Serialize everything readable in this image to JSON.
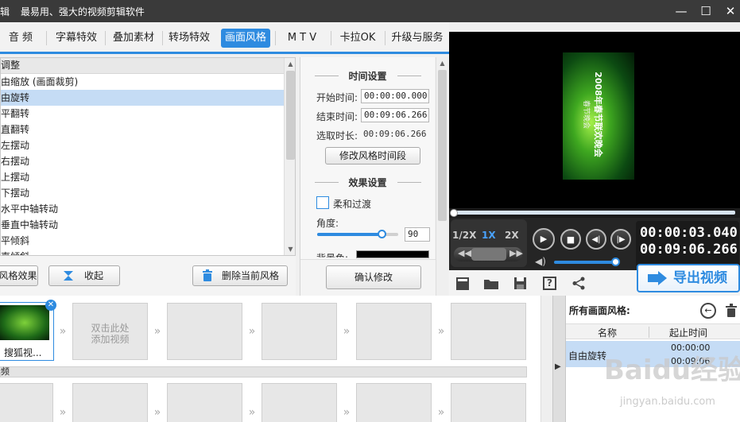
{
  "app": {
    "title_char": "辑",
    "title": "最易用、强大的视频剪辑软件",
    "window_buttons": {
      "minimize": "—",
      "maximize": "☐",
      "close": "✕"
    }
  },
  "tabs": [
    {
      "label": "音 频",
      "active": false
    },
    {
      "label": "字幕特效",
      "active": false
    },
    {
      "label": "叠加素材",
      "active": false
    },
    {
      "label": "转场特效",
      "active": false
    },
    {
      "label": "画面风格",
      "active": true
    },
    {
      "label": "M T V",
      "active": false
    },
    {
      "label": "卡拉OK",
      "active": false
    },
    {
      "label": "升级与服务",
      "active": false
    }
  ],
  "style_list": {
    "header": "调整",
    "items": [
      "由缩放 (画面裁剪)",
      "由旋转",
      "平翻转",
      "直翻转",
      "左摆动",
      "右摆动",
      "上摆动",
      "下摆动",
      "水平中轴转动",
      "垂直中轴转动",
      "平倾斜",
      "直倾斜"
    ],
    "selected_index": 1
  },
  "list_buttons": {
    "add_effect": "风格效果",
    "collapse": "收起",
    "delete_current": "删除当前风格"
  },
  "settings": {
    "time_section": "时间设置",
    "start_label": "开始时间:",
    "start_value": "00:00:00.000",
    "end_label": "结束时间:",
    "end_value": "00:09:06.266",
    "duration_label": "选取时长:",
    "duration_value": "00:09:06.266",
    "modify_time_button": "修改风格时间段",
    "effect_section": "效果设置",
    "soft_transition_label": "柔和过渡",
    "soft_transition_checked": false,
    "angle_label": "角度:",
    "angle_value": "90",
    "angle_slider_fraction": 0.8,
    "bg_color_label": "背景色:",
    "bg_color": "#000000",
    "confirm_button": "确认修改"
  },
  "preview": {
    "video_caption_line1": "2008年春节联欢晚会",
    "video_caption_line2": "春节晚会",
    "seek_fraction": 0.0
  },
  "playback": {
    "speeds": [
      "1/2X",
      "1X",
      "2X"
    ],
    "active_speed": "1X",
    "current_time": "00:00:03.040",
    "total_time": "00:09:06.266",
    "volume_fraction": 1.0
  },
  "toolbar": {
    "export_button": "导出视频",
    "icons": [
      "new-icon",
      "open-folder-icon",
      "save-icon",
      "help-icon",
      "share-icon"
    ]
  },
  "timeline": {
    "clip_label": "搜狐视...",
    "add_video_hint_line1": "双击此处",
    "add_video_hint_line2": "添加视频",
    "audio_track_label": "频"
  },
  "right_panel": {
    "title": "所有画面风格:",
    "col_name": "名称",
    "col_time": "起止时间",
    "rows": [
      {
        "name": "自由旋转",
        "start": "00:00:00",
        "end": "00:09:06"
      }
    ]
  },
  "watermark": {
    "text": "Baidu经验",
    "url": "jingyan.baidu.com"
  },
  "colors": {
    "accent": "#2e8be0",
    "selection": "#c5dcf5",
    "titlebar": "#3a3a3a"
  }
}
